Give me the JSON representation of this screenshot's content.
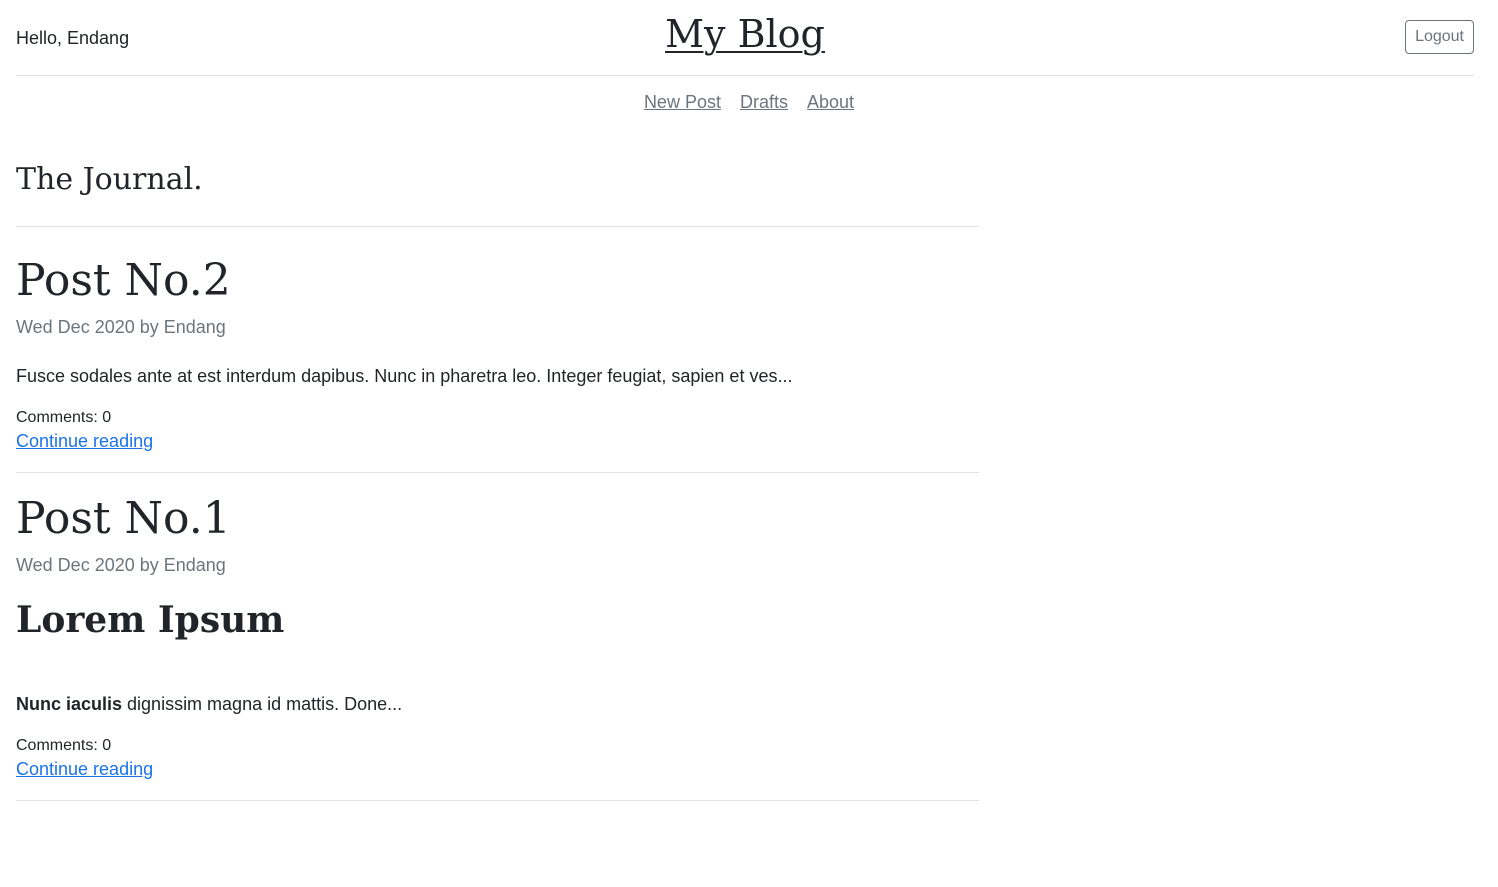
{
  "header": {
    "greeting": "Hello, Endang",
    "site_title": "My Blog",
    "logout_label": "Logout"
  },
  "nav": {
    "items": [
      {
        "label": "New Post"
      },
      {
        "label": "Drafts"
      },
      {
        "label": "About"
      }
    ]
  },
  "main": {
    "title": "The Journal.",
    "posts": [
      {
        "title": "Post No.2",
        "meta": "Wed Dec 2020 by Endang",
        "excerpt": "Fusce sodales ante at est interdum dapibus. Nunc in pharetra leo. Integer feugiat, sapien et ves...",
        "comments": "Comments: 0",
        "continue_label": "Continue reading"
      },
      {
        "title": "Post No.1",
        "meta": "Wed Dec 2020 by Endang",
        "heading": "Lorem Ipsum",
        "excerpt_bold": "Nunc iaculis",
        "excerpt": " dignissim magna id mattis. Done...",
        "comments": "Comments: 0",
        "continue_label": "Continue reading"
      }
    ]
  },
  "colors": {
    "text": "#212529",
    "muted": "#6c757d",
    "link": "#1a73e8",
    "divider": "#dee2e6"
  }
}
